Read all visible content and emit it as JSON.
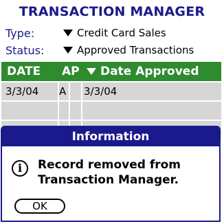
{
  "app": {
    "title": "TRANSACTION MANAGER"
  },
  "filters": {
    "type": {
      "label": "Type:",
      "value": "Credit Card Sales",
      "icon": "triangle-down-icon"
    },
    "status": {
      "label": "Status:",
      "value": "Approved Transactions",
      "icon": "triangle-down-icon"
    }
  },
  "table": {
    "headers": {
      "date": "DATE",
      "ap": "AP",
      "sort": "Date Approved"
    },
    "rows": [
      {
        "date": "3/3/04",
        "ap": "A",
        "approved": "3/3/04"
      },
      {
        "date": "",
        "ap": "",
        "approved": ""
      },
      {
        "date": "",
        "ap": "",
        "approved": ""
      }
    ],
    "header_color": "#2e8b2e",
    "row_color": "#d6d6d6"
  },
  "dialog": {
    "title": "Information",
    "message": "Record removed from Transaction Manager.",
    "icon": "info-icon",
    "icon_glyph": "i",
    "ok_label": "OK"
  },
  "colors": {
    "accent": "#1a1a8c",
    "header_green": "#2e8b2e"
  }
}
